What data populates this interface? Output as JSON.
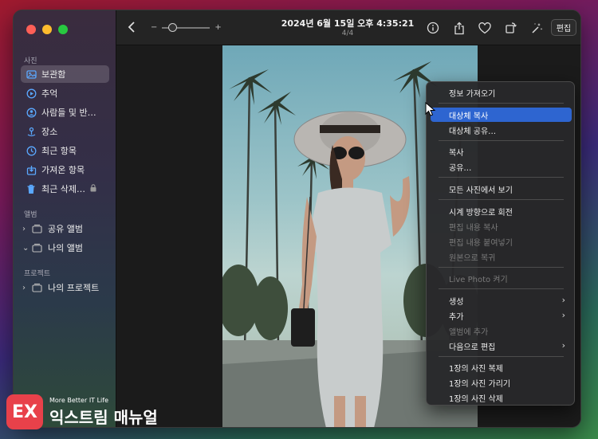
{
  "sidebar": {
    "section_photos": "사진",
    "section_albums": "앨범",
    "section_projects": "프로젝트",
    "items": [
      {
        "label": "보관함",
        "icon": "library-icon"
      },
      {
        "label": "추억",
        "icon": "memories-icon"
      },
      {
        "label": "사람들 및 반…",
        "icon": "people-icon"
      },
      {
        "label": "장소",
        "icon": "places-icon"
      },
      {
        "label": "최근 항목",
        "icon": "recents-icon"
      },
      {
        "label": "가져온 항목",
        "icon": "imports-icon"
      },
      {
        "label": "최근 삭제…",
        "icon": "trash-icon"
      }
    ],
    "albums": [
      {
        "label": "공유 앨범"
      },
      {
        "label": "나의 앨범"
      }
    ],
    "projects": [
      {
        "label": "나의 프로젝트"
      }
    ]
  },
  "toolbar": {
    "title": "2024년 6월 15일 오후 4:35:21",
    "subtitle": "4/4",
    "zoom_minus": "−",
    "zoom_plus": "+",
    "edit_label": "편집"
  },
  "context_menu": {
    "items": [
      {
        "label": "정보 가져오기"
      },
      {
        "label": "대상체 복사"
      },
      {
        "label": "대상체 공유…"
      },
      {
        "label": "복사"
      },
      {
        "label": "공유…"
      },
      {
        "label": "모든 사진에서 보기"
      },
      {
        "label": "시계 방향으로 회전"
      },
      {
        "label": "편집 내용 복사"
      },
      {
        "label": "편집 내용 붙여넣기"
      },
      {
        "label": "원본으로 복귀"
      },
      {
        "label": "Live Photo 켜기"
      },
      {
        "label": "생성"
      },
      {
        "label": "추가"
      },
      {
        "label": "앨범에 추가"
      },
      {
        "label": "다음으로 편집"
      },
      {
        "label": "1장의 사진 복제"
      },
      {
        "label": "1장의 사진 가리기"
      },
      {
        "label": "1장의 사진 삭제"
      }
    ]
  },
  "watermark": {
    "tagline": "More Better IT Life",
    "brand": "익스트림 매뉴얼"
  }
}
